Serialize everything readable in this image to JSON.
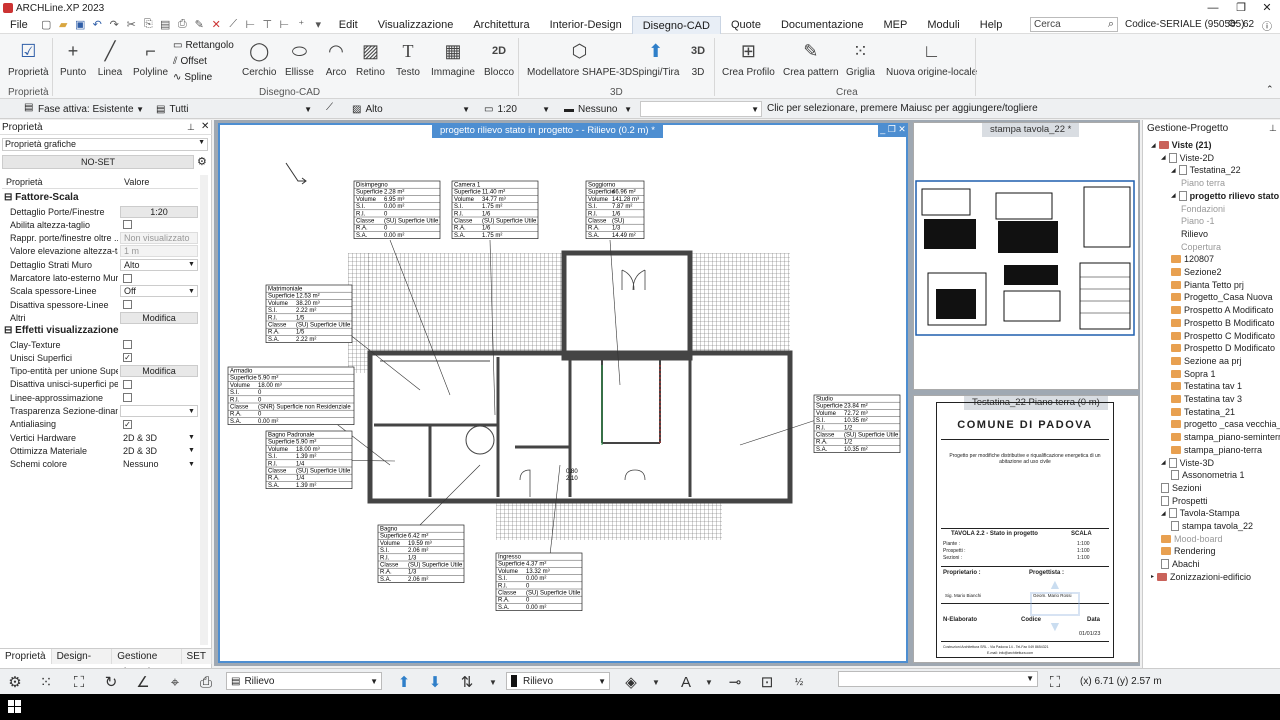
{
  "app": {
    "title": "ARCHLine.XP 2023"
  },
  "menu": {
    "file": "File",
    "items": [
      "Edit",
      "Visualizzazione",
      "Architettura",
      "Interior-Design",
      "Disegno-CAD",
      "Quote",
      "Documentazione",
      "MEP",
      "Moduli",
      "Help"
    ],
    "active": "Disegno-CAD"
  },
  "search": {
    "placeholder": "Cerca"
  },
  "license": {
    "text": "Codice-SERIALE (950565)",
    "count": "62"
  },
  "ribbon": {
    "proprieta": "Proprietà",
    "punto": "Punto",
    "linea": "Linea",
    "polyline": "Polyline",
    "rettangolo": "Rettangolo",
    "offset": "Offset",
    "spline": "Spline",
    "cerchio": "Cerchio",
    "ellisse": "Ellisse",
    "arco": "Arco",
    "retino": "Retino",
    "testo": "Testo",
    "immagine": "Immagine",
    "blocco": "Blocco",
    "modellatore": "Modellatore SHAPE-3D",
    "spingi": "Spingi/Tira",
    "tred": "3D",
    "creaprofilo": "Crea Profilo",
    "creapattern": "Crea pattern",
    "griglia": "Griglia",
    "origine": "Nuova origine-locale",
    "group_prop": "Proprietà",
    "group_cad": "Disegno-CAD",
    "group_3d": "3D",
    "group_crea": "Crea"
  },
  "options": {
    "fase": "Fase attiva: Esistente",
    "tutti": "Tutti",
    "alto": "Alto",
    "scala": "1:20",
    "nessuno": "Nessuno",
    "hint": "Clic per selezionare, premere Maiusc per aggiungere/togliere"
  },
  "leftpanel": {
    "title": "Proprietà",
    "combo": "Proprietà grafiche",
    "noset": "NO-SET",
    "col_prop": "Proprietà",
    "col_val": "Valore",
    "sec1": "Fattore-Scala",
    "sec2": "Effetti visualizzazione",
    "rows1": [
      [
        "Dettaglio Porte/Finestre",
        "1:20"
      ],
      [
        "Abilita altezza-taglio",
        ""
      ],
      [
        "Rappr. porte/finestre oltre ...",
        "Non visualizzato"
      ],
      [
        "Valore elevazione altezza-taglio:",
        "1 m"
      ],
      [
        "Dettaglio Strati Muro",
        "Alto"
      ],
      [
        "Marcatore lato-esterno Muro",
        ""
      ],
      [
        "Scala spessore-Linee",
        "Off"
      ],
      [
        "Disattiva spessore-Linee",
        ""
      ],
      [
        "Altri",
        "Modifica"
      ]
    ],
    "rows2": [
      [
        "Clay-Texture",
        ""
      ],
      [
        "Unisci Superfici",
        "✓"
      ],
      [
        "Tipo-entità per unione Superfici",
        "Modifica"
      ],
      [
        "Disattiva unisci-superfici per Tetti",
        ""
      ],
      [
        "Linee-approssimazione",
        ""
      ],
      [
        "Trasparenza Sezione-dinami...",
        ""
      ],
      [
        "Antialiasing",
        "✓"
      ],
      [
        "Vertici Hardware",
        "2D & 3D"
      ],
      [
        "Ottimizza Materiale",
        "2D & 3D"
      ],
      [
        "Schemi colore",
        "Nessuno"
      ]
    ]
  },
  "lefttabs": [
    "Proprietà",
    "Design-Center",
    "Gestione Sistemi",
    "SET"
  ],
  "views": {
    "main": "progetto rilievo stato in progetto -  - Rilievo (0.2 m) *",
    "print": "stampa tavola_22 *",
    "testatina": "Testatina_22 Piano terra (0 m)"
  },
  "rooms": [
    {
      "name": "Disimpegno",
      "rows": [
        [
          "Superficie",
          "2.28 m²"
        ],
        [
          "Volume",
          "6.95 m³"
        ],
        [
          "S.I.",
          "0.00 m²"
        ],
        [
          "R.I.",
          "0"
        ],
        [
          "Classe",
          "(SU) Superficie Utile"
        ],
        [
          "R.A.",
          "0"
        ],
        [
          "S.A.",
          "0.00 m²"
        ]
      ]
    },
    {
      "name": "Camera 1",
      "rows": [
        [
          "Superficie",
          "11.40 m²"
        ],
        [
          "Volume",
          "34.77 m³"
        ],
        [
          "S.I.",
          "1.75 m²"
        ],
        [
          "R.I.",
          "1/6"
        ],
        [
          "Classe",
          "(SU) Superficie Utile"
        ],
        [
          "R.A.",
          "1/6"
        ],
        [
          "S.A.",
          "1.75 m²"
        ]
      ]
    },
    {
      "name": "Soggiorno",
      "rows": [
        [
          "Superficie",
          "46.96 m²"
        ],
        [
          "Volume",
          "141.28 m³"
        ],
        [
          "S.I.",
          "7.87 m²"
        ],
        [
          "R.I.",
          "1/6"
        ],
        [
          "Classe",
          "(SU)"
        ],
        [
          "R.A.",
          "1/3"
        ],
        [
          "S.A.",
          "14.49 m²"
        ]
      ]
    },
    {
      "name": "Matrimoniale",
      "rows": [
        [
          "Superficie",
          "12.53 m²"
        ],
        [
          "Volume",
          "38.20 m³"
        ],
        [
          "S.I.",
          "2.22 m²"
        ],
        [
          "R.I.",
          "1/5"
        ],
        [
          "Classe",
          "(SU) Superficie Utile"
        ],
        [
          "R.A.",
          "1/5"
        ],
        [
          "S.A.",
          "2.22 m²"
        ]
      ]
    },
    {
      "name": "Armadio",
      "rows": [
        [
          "Superficie",
          "5.90 m²"
        ],
        [
          "Volume",
          "18.00 m³"
        ],
        [
          "S.I.",
          "0"
        ],
        [
          "R.I.",
          "0"
        ],
        [
          "Classe",
          "(SNR) Superficie non Residenziale"
        ],
        [
          "R.A.",
          "0"
        ],
        [
          "S.A.",
          "0.00 m²"
        ]
      ]
    },
    {
      "name": "Bagno Padronale",
      "rows": [
        [
          "Superficie",
          "5.90 m²"
        ],
        [
          "Volume",
          "18.00 m³"
        ],
        [
          "S.I.",
          "1.39 m²"
        ],
        [
          "R.I.",
          "1/4"
        ],
        [
          "Classe",
          "(SU) Superficie Utile"
        ],
        [
          "R.A.",
          "1/4"
        ],
        [
          "S.A.",
          "1.39 m²"
        ]
      ]
    },
    {
      "name": "Studio",
      "rows": [
        [
          "Superficie",
          "23.84 m²"
        ],
        [
          "Volume",
          "72.72 m³"
        ],
        [
          "S.I.",
          "10.35 m²"
        ],
        [
          "R.I.",
          "1/2"
        ],
        [
          "Classe",
          "(SU) Superficie Utile"
        ],
        [
          "R.A.",
          "1/2"
        ],
        [
          "S.A.",
          "10.35 m²"
        ]
      ]
    },
    {
      "name": "Bagno",
      "rows": [
        [
          "Superficie",
          "6.42 m²"
        ],
        [
          "Volume",
          "19.59 m³"
        ],
        [
          "S.I.",
          "2.06 m²"
        ],
        [
          "R.I.",
          "1/3"
        ],
        [
          "Classe",
          "(SU) Superficie Utile"
        ],
        [
          "R.A.",
          "1/3"
        ],
        [
          "S.A.",
          "2.06 m²"
        ]
      ]
    },
    {
      "name": "Ingresso",
      "rows": [
        [
          "Superficie",
          "4.37 m²"
        ],
        [
          "Volume",
          "13.32 m³"
        ],
        [
          "S.I.",
          "0.00 m²"
        ],
        [
          "R.I.",
          "0"
        ],
        [
          "Classe",
          "(SU) Superficie Utile"
        ],
        [
          "R.A.",
          "0"
        ],
        [
          "S.A.",
          "0.00 m²"
        ]
      ]
    }
  ],
  "dims": {
    "a": "0.80",
    "b": "2.10"
  },
  "testatina": {
    "comune": "COMUNE DI PADOVA",
    "progetto": "Progetto per modifiche distributive e riqualificazione energetica di un abitazione ad uso civile",
    "tavola": "TAVOLA 2.2 - Stato in progetto",
    "scala": "SCALA",
    "piante": "Piante :",
    "prospetti": "Prospetti :",
    "sezioni": "Sezioni :",
    "s1": "1:100",
    "s2": "1:100",
    "s3": "1:100",
    "proprietario": "Proprietario :",
    "progettista": "Progettista :",
    "prop_name": "Sig. Mario Bianchi",
    "prog_name": "Geom. Mario Rossi",
    "codice": "Codice",
    "data": "Data",
    "elaborato": "N-Elaborato",
    "date": "01/01/23",
    "footer1": "Costruzioni Architettura SRL - Via Padova 14 - Tel-Fax 049 8654321",
    "footer2": "E-mail: info@architettura.com"
  },
  "tree": {
    "title": "Gestione-Progetto",
    "items": [
      {
        "t": "Viste (21)",
        "l": 0,
        "i": "v",
        "b": true
      },
      {
        "t": "Viste-2D",
        "l": 1,
        "i": "doc"
      },
      {
        "t": "Testatina_22",
        "l": 2,
        "i": "doc"
      },
      {
        "t": "Piano terra",
        "l": 3,
        "i": "",
        "g": true
      },
      {
        "t": "progetto rilievo stato in p",
        "l": 2,
        "i": "doc",
        "b": true
      },
      {
        "t": "Fondazioni",
        "l": 3,
        "i": "",
        "g": true
      },
      {
        "t": "Piano -1",
        "l": 3,
        "i": "",
        "g": true
      },
      {
        "t": "Rilievo",
        "l": 3,
        "i": ""
      },
      {
        "t": "Copertura",
        "l": 3,
        "i": "",
        "g": true
      },
      {
        "t": "120807",
        "l": 2,
        "i": "f"
      },
      {
        "t": "Sezione2",
        "l": 2,
        "i": "f"
      },
      {
        "t": "Pianta Tetto prj",
        "l": 2,
        "i": "f"
      },
      {
        "t": "Progetto_Casa Nuova",
        "l": 2,
        "i": "f"
      },
      {
        "t": "Prospetto A Modificato",
        "l": 2,
        "i": "f"
      },
      {
        "t": "Prospetto B Modificato",
        "l": 2,
        "i": "f"
      },
      {
        "t": "Prospetto C Modificato",
        "l": 2,
        "i": "f"
      },
      {
        "t": "Prospetto D Modificato",
        "l": 2,
        "i": "f"
      },
      {
        "t": "Sezione aa prj",
        "l": 2,
        "i": "f"
      },
      {
        "t": "Sopra 1",
        "l": 2,
        "i": "f"
      },
      {
        "t": "Testatina tav 1",
        "l": 2,
        "i": "f"
      },
      {
        "t": "Testatina tav 3",
        "l": 2,
        "i": "f"
      },
      {
        "t": "Testatina_21",
        "l": 2,
        "i": "f"
      },
      {
        "t": "progetto _casa vecchia_La",
        "l": 2,
        "i": "f"
      },
      {
        "t": "stampa_piano-seminterrat",
        "l": 2,
        "i": "f"
      },
      {
        "t": "stampa_piano-terra",
        "l": 2,
        "i": "f"
      },
      {
        "t": "Viste-3D",
        "l": 1,
        "i": "doc"
      },
      {
        "t": "Assonometria 1",
        "l": 2,
        "i": "doc"
      },
      {
        "t": "Sezioni",
        "l": 1,
        "i": "doc"
      },
      {
        "t": "Prospetti",
        "l": 1,
        "i": "doc"
      },
      {
        "t": "Tavola-Stampa",
        "l": 1,
        "i": "doc"
      },
      {
        "t": "stampa tavola_22",
        "l": 2,
        "i": "doc"
      },
      {
        "t": "Mood-board",
        "l": 1,
        "i": "f",
        "g": true
      },
      {
        "t": "Rendering",
        "l": 1,
        "i": "f"
      },
      {
        "t": "Abachi",
        "l": 1,
        "i": "doc"
      },
      {
        "t": "Zonizzazioni-edificio",
        "l": 0,
        "i": "v"
      }
    ]
  },
  "bottom": {
    "layer": "Rilievo",
    "layer2": "Rilievo",
    "coords": "(x) 6.71  (y) 2.57 m"
  },
  "colors": {
    "accent": "#4d8ed1",
    "wall": "#555555"
  }
}
